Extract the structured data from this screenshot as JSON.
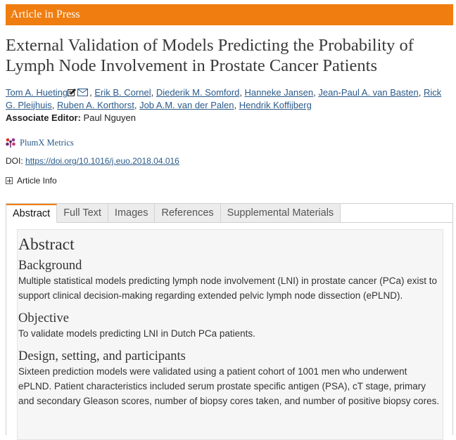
{
  "banner": {
    "label": "Article in Press"
  },
  "article": {
    "title": "External Validation of Models Predicting the Probability of Lymph Node Involvement in Prostate Cancer Patients",
    "authors": [
      "Tom A. Hueting",
      "Erik B. Cornel",
      "Diederik M. Somford",
      "Hanneke Jansen",
      "Jean-Paul A. van Basten",
      "Rick G. Pleijhuis",
      "Ruben A. Korthorst",
      "Job A.M. van der Palen",
      "Hendrik Koffijberg"
    ],
    "associate_editor_label": "Associate Editor:",
    "associate_editor": "Paul Nguyen",
    "plumx_label": "PlumX Metrics",
    "doi_label": "DOI:",
    "doi": "https://doi.org/10.1016/j.euo.2018.04.016",
    "article_info_label": "Article Info"
  },
  "tabs": [
    {
      "label": "Abstract",
      "active": true
    },
    {
      "label": "Full Text",
      "active": false
    },
    {
      "label": "Images",
      "active": false
    },
    {
      "label": "References",
      "active": false
    },
    {
      "label": "Supplemental Materials",
      "active": false
    }
  ],
  "abstract": {
    "heading": "Abstract",
    "sections": [
      {
        "heading": "Background",
        "text": "Multiple statistical models predicting lymph node involvement (LNI) in prostate cancer (PCa) exist to support clinical decision-making regarding extended pelvic lymph node dissection (ePLND)."
      },
      {
        "heading": "Objective",
        "text": "To validate models predicting LNI in Dutch PCa patients."
      },
      {
        "heading": "Design, setting, and participants",
        "text": "Sixteen prediction models were validated using a patient cohort of 1001 men who underwent ePLND. Patient characteristics included serum prostate specific antigen (PSA), cT stage, primary and secondary Gleason scores, number of biopsy cores taken, and number of positive biopsy cores."
      }
    ]
  },
  "colors": {
    "accent": "#f07d0f",
    "link": "#2a5a8a",
    "panel_bg": "#f6f6f6"
  },
  "icons": [
    "edit-icon",
    "email-icon",
    "plumx-icon",
    "expand-plus-icon"
  ]
}
